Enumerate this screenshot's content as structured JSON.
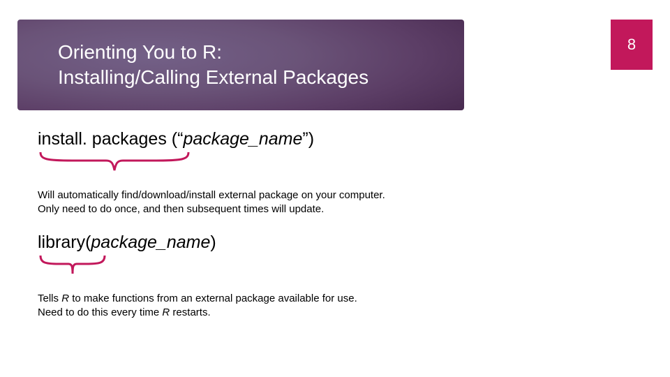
{
  "page_number": "8",
  "header": {
    "title_line1": "Orienting You to R:",
    "title_line2": "Installing/Calling External Packages"
  },
  "section1": {
    "code_prefix": "install. packages (“",
    "code_arg": "package_name",
    "code_suffix": "”)",
    "desc_line1": "Will automatically find/download/install external package on your computer.",
    "desc_line2": "Only need to do once, and then subsequent times will update."
  },
  "section2": {
    "code_prefix": "library(",
    "code_arg": "package_name",
    "code_suffix": ")",
    "desc_part1": "Tells ",
    "desc_ital1": "R",
    "desc_part2": " to make functions from an external package available for use.",
    "desc_line2a": "Need to do this every time ",
    "desc_ital2": "R",
    "desc_line2b": " restarts."
  },
  "colors": {
    "accent": "#c2185b"
  }
}
